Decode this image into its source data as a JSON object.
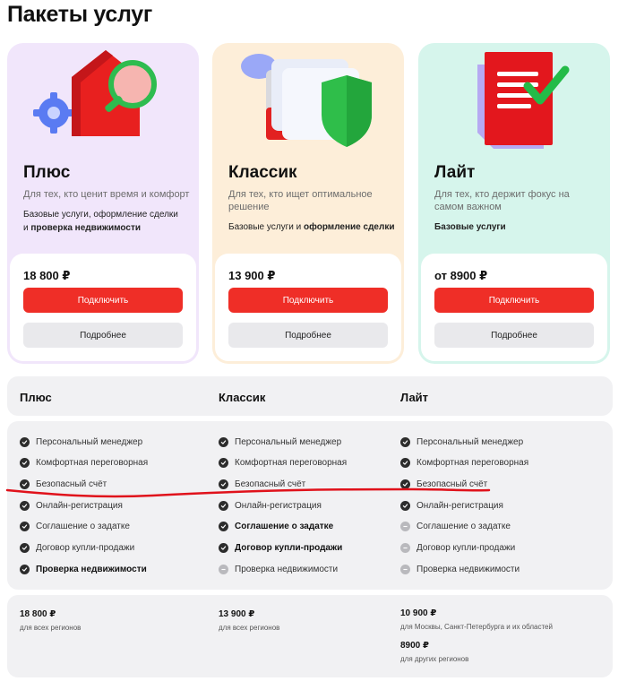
{
  "page": {
    "title": "Пакеты услуг"
  },
  "cards": [
    {
      "name": "Плюс",
      "desc": "Для тех, кто ценит время и комфорт",
      "incl_line1": "Базовые услуги, оформление сделки",
      "incl_and": "и ",
      "incl_bold": "проверка недвижимости",
      "price": "18 800 ₽",
      "connect": "Подключить",
      "more": "Подробнее"
    },
    {
      "name": "Классик",
      "desc": "Для тех, кто ищет оптимальное решение",
      "incl_plain": "Базовые услуги и ",
      "incl_bold": "оформление сделки",
      "price": "13 900 ₽",
      "connect": "Подключить",
      "more": "Подробнее"
    },
    {
      "name": "Лайт",
      "desc": "Для тех, кто держит фокус на самом важном",
      "incl_bold": "Базовые услуги",
      "price": "от 8900 ₽",
      "connect": "Подключить",
      "more": "Подробнее"
    }
  ],
  "compare": {
    "headers": [
      "Плюс",
      "Классик",
      "Лайт"
    ],
    "features": [
      "Персональный менеджер",
      "Комфортная переговорная",
      "Безопасный счёт",
      "Онлайн-регистрация",
      "Соглашение о задатке",
      "Договор купли-продажи",
      "Проверка недвижимости"
    ],
    "availability": {
      "plus": [
        true,
        true,
        true,
        true,
        true,
        true,
        true
      ],
      "classic": [
        true,
        true,
        true,
        true,
        true,
        true,
        false
      ],
      "lite": [
        true,
        true,
        true,
        true,
        false,
        false,
        false
      ]
    }
  },
  "prices": {
    "plus": {
      "price": "18 800 ₽",
      "region": "для всех регионов"
    },
    "classic": {
      "price": "13 900 ₽",
      "region": "для всех регионов"
    },
    "lite": [
      {
        "price": "10 900 ₽",
        "region": "для Москвы, Санкт-Петербурга и их областей"
      },
      {
        "price": "8900 ₽",
        "region": "для других регионов"
      }
    ]
  },
  "colors": {
    "accent": "#ef2e27",
    "plus_bg": "#f1e6fb",
    "classic_bg": "#fdeed9",
    "lite_bg": "#d6f5ec",
    "panel_bg": "#f1f1f3"
  }
}
